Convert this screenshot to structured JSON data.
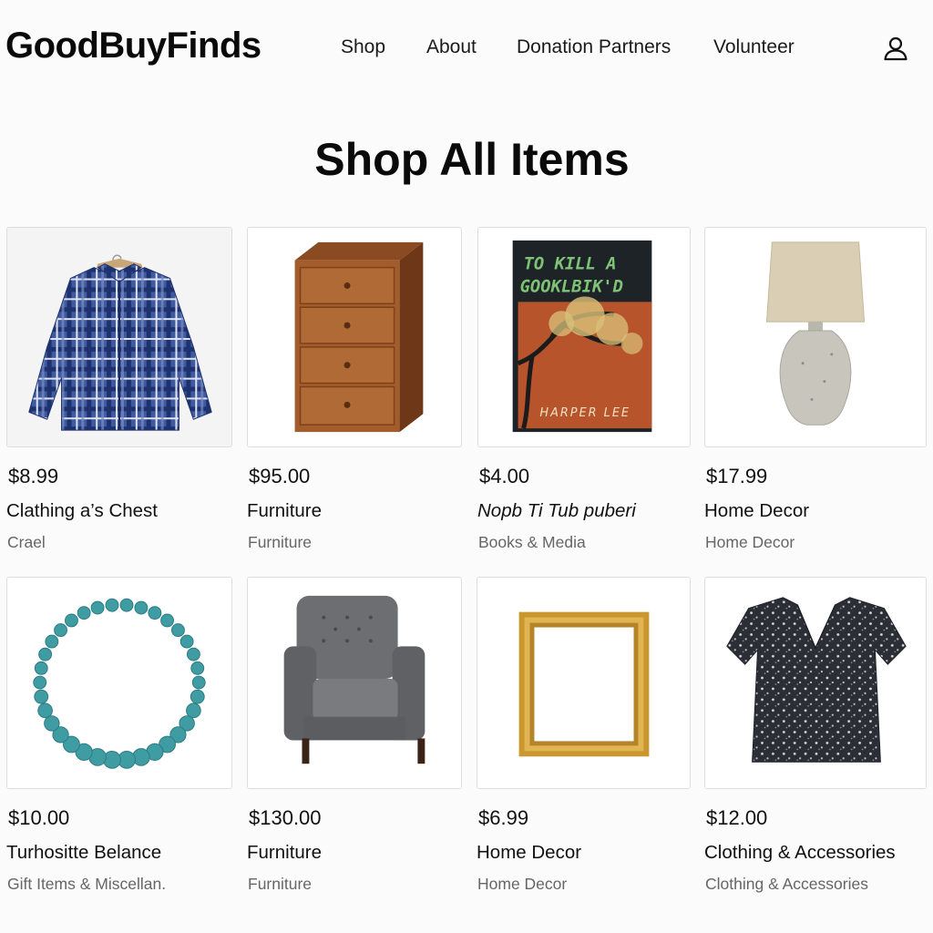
{
  "site": {
    "logo": "GoodBuyFinds"
  },
  "nav": {
    "items": [
      {
        "label": "Shop"
      },
      {
        "label": "About"
      },
      {
        "label": "Donation Partners"
      },
      {
        "label": "Volunteer"
      }
    ],
    "account_icon": "user-icon"
  },
  "page": {
    "title": "Shop All Items"
  },
  "products": [
    {
      "price": "$8.99",
      "title": "Clathing a’s Chest",
      "category": "Crael",
      "image": "plaid-shirt"
    },
    {
      "price": "$95.00",
      "title": "Furniture",
      "category": "Furniture",
      "image": "wooden-dresser"
    },
    {
      "price": "$4.00",
      "title": "Nopb Ti Tub puberi",
      "category": "Books & Media",
      "image": "book",
      "book": {
        "title_line1": "TO KILL A",
        "title_line2": "GOOKLBIK'D",
        "author": "HARPER LEE"
      }
    },
    {
      "price": "$17.99",
      "title": "Home Decor",
      "category": "Home Decor",
      "image": "table-lamp"
    },
    {
      "price": "$10.00",
      "title": "Turhositte Belance",
      "category": "Gift Items & Miscellan.",
      "image": "bead-necklace"
    },
    {
      "price": "$130.00",
      "title": "Furniture",
      "category": "Furniture",
      "image": "armchair"
    },
    {
      "price": "$6.99",
      "title": "Home Decor",
      "category": "Home Decor",
      "image": "picture-frame"
    },
    {
      "price": "$12.00",
      "title": "Clothing & Accessories",
      "category": "Clothing & Accessories",
      "image": "floral-blouse"
    }
  ],
  "colors": {
    "background": "#fbfbfc",
    "text": "#111111",
    "muted": "#666666",
    "card_border": "#dedede"
  }
}
